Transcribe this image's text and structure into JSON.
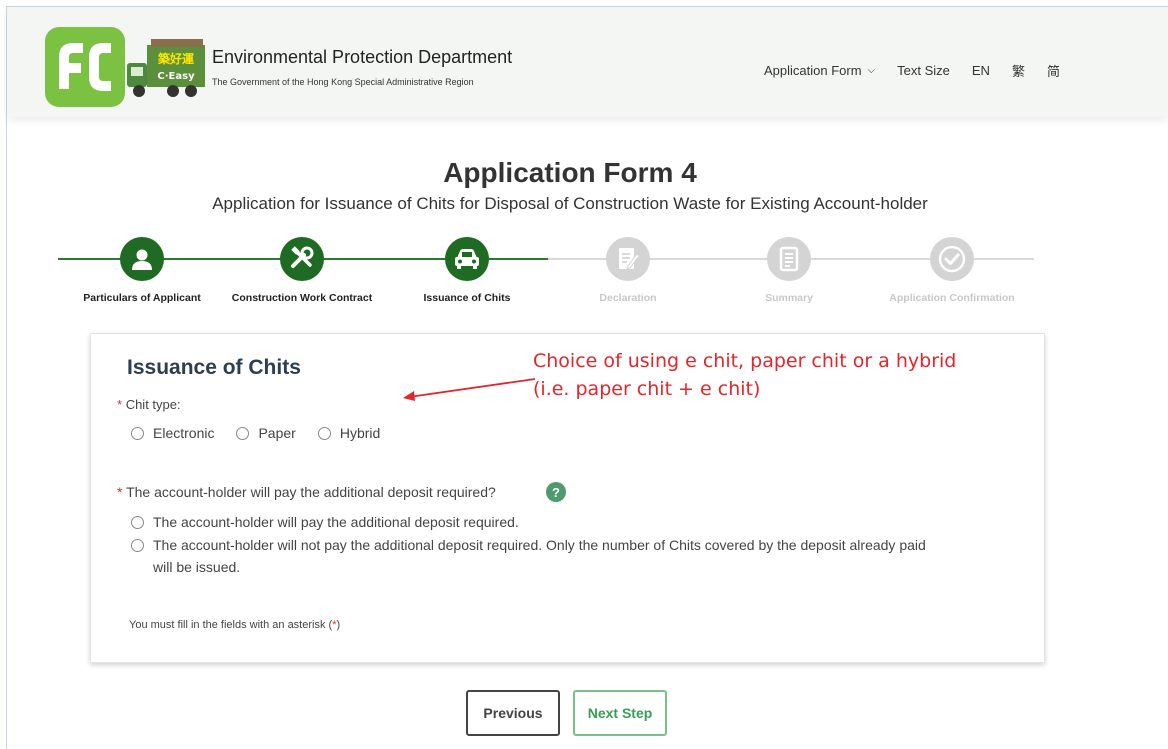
{
  "header": {
    "department": "Environmental Protection Department",
    "government": "The Government of the Hong Kong Special Administrative Region",
    "logo_text_cn": "築好運",
    "logo_text_en": "C·Easy",
    "nav": {
      "application_form": "Application Form",
      "text_size": "Text Size",
      "lang_en": "EN",
      "lang_tc": "繁",
      "lang_sc": "简"
    }
  },
  "page": {
    "title": "Application Form 4",
    "subtitle": "Application for Issuance of Chits for Disposal of Construction Waste for Existing Account-holder"
  },
  "steps": [
    {
      "label": "Particulars of Applicant",
      "state": "active",
      "icon": "user-icon"
    },
    {
      "label": "Construction Work Contract",
      "state": "active",
      "icon": "tools-icon"
    },
    {
      "label": "Issuance of Chits",
      "state": "active",
      "icon": "car-icon"
    },
    {
      "label": "Declaration",
      "state": "inactive",
      "icon": "edit-document-icon"
    },
    {
      "label": "Summary",
      "state": "inactive",
      "icon": "document-list-icon"
    },
    {
      "label": "Application Confirmation",
      "state": "inactive",
      "icon": "check-circle-icon"
    }
  ],
  "card": {
    "title": "Issuance of Chits",
    "required_mark": "*",
    "chit_type_label": "Chit type:",
    "chit_type_options": [
      "Electronic",
      "Paper",
      "Hybrid"
    ],
    "deposit_label": "The account-holder will pay the additional deposit required?",
    "help_mark": "?",
    "deposit_options": [
      "The account-holder will pay the additional deposit required.",
      "The account-holder will not pay the additional deposit required. Only the number of Chits covered by the deposit already paid",
      "will be issued."
    ],
    "note_prefix": "You must fill in the fields with an asterisk (",
    "note_mark": "*",
    "note_suffix": ")"
  },
  "annotation": {
    "line1": "Choice of using e chit, paper chit or a hybrid",
    "line2": "(i.e. paper chit + e chit)"
  },
  "buttons": {
    "previous": "Previous",
    "next": "Next Step"
  },
  "colors": {
    "primary_green": "#1f6b24",
    "inactive_grey": "#d4d4d4",
    "required_red": "#d9302c",
    "annotation_red": "#e3262b",
    "next_green": "#3a9d56"
  }
}
